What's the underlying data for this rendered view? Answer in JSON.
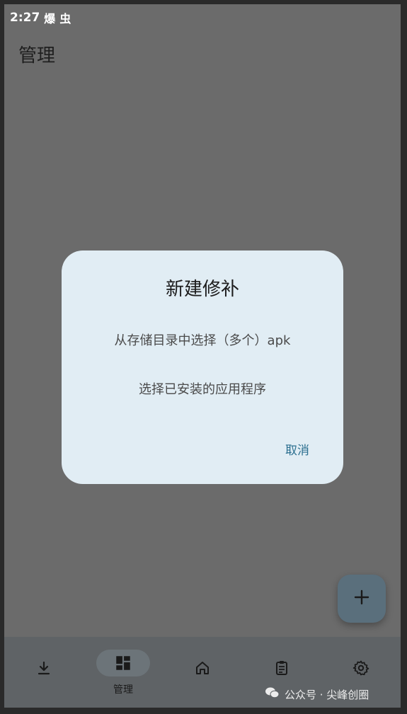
{
  "status_bar": {
    "time": "2:27",
    "icon_1": "爆",
    "icon_2": "虫"
  },
  "header": {
    "title": "管理"
  },
  "dialog": {
    "title": "新建修补",
    "options": [
      "从存储目录中选择（多个）apk",
      "选择已安装的应用程序"
    ],
    "cancel_label": "取消"
  },
  "fab": {
    "icon": "plus-icon"
  },
  "bottom_nav": {
    "items": [
      {
        "icon": "download-icon",
        "label": ""
      },
      {
        "icon": "grid-icon",
        "label": "管理",
        "selected": true
      },
      {
        "icon": "home-icon",
        "label": ""
      },
      {
        "icon": "clipboard-icon",
        "label": ""
      },
      {
        "icon": "gear-icon",
        "label": ""
      }
    ]
  },
  "watermark": {
    "text": "公众号 · 尖峰创圈",
    "icon": "wechat-icon"
  },
  "colors": {
    "scrim": "#6b6b6b",
    "dialog_bg": "#e1edf4",
    "accent": "#2b6f8f",
    "fab_bg": "#5a6f7c",
    "nav_bg": "#5f6366"
  }
}
